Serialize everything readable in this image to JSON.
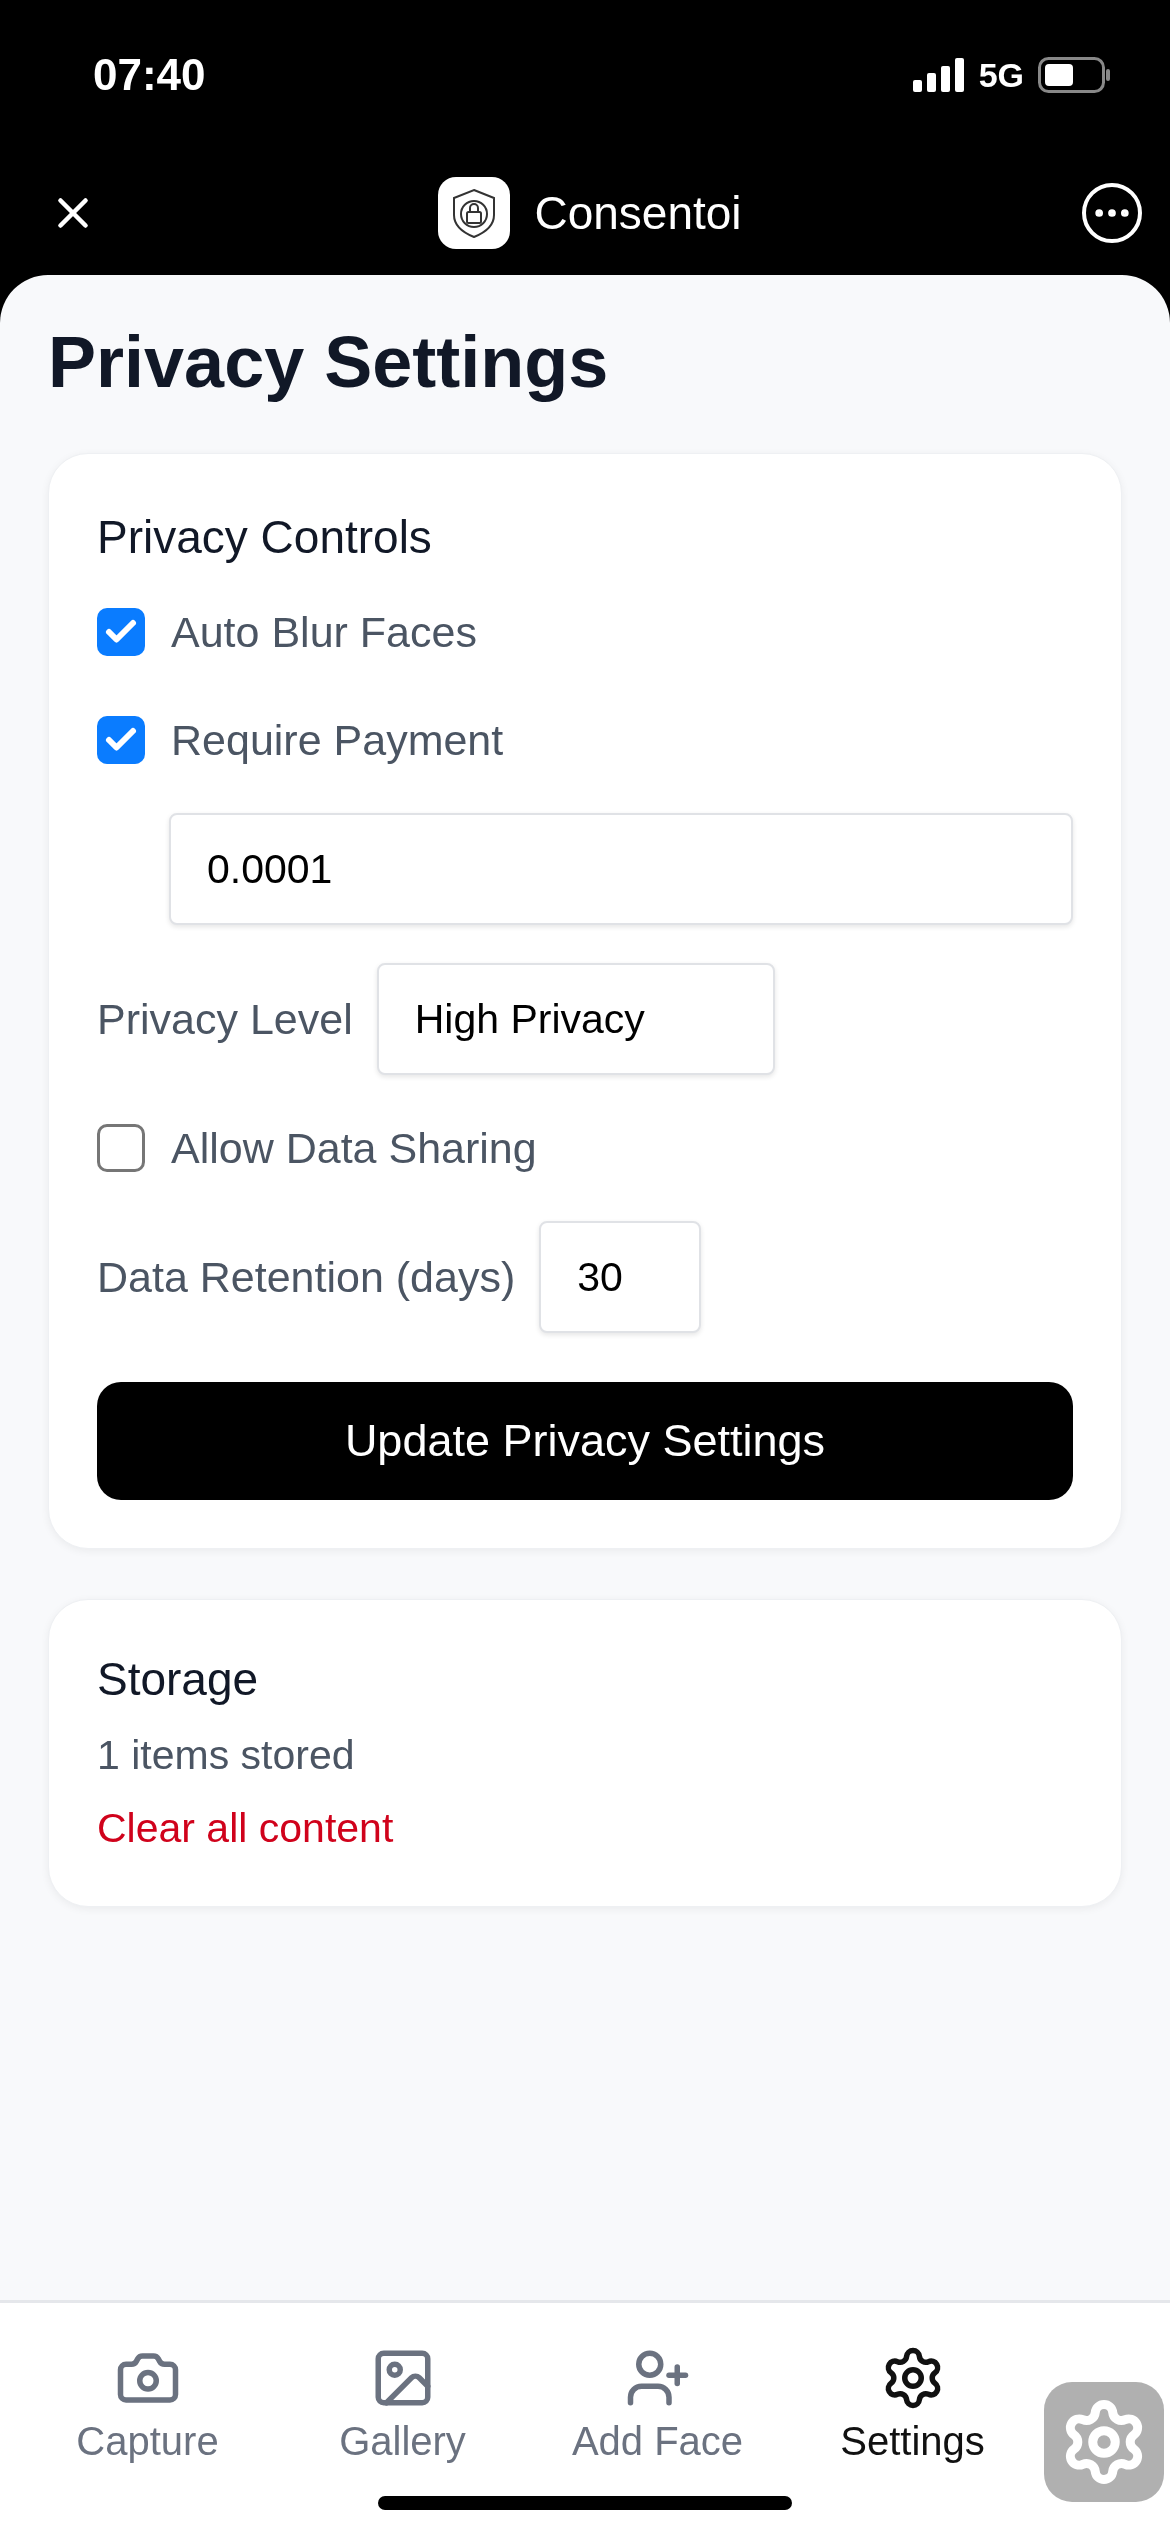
{
  "status_bar": {
    "time": "07:40",
    "network": "5G"
  },
  "nav_bar": {
    "title": "Consentoi"
  },
  "page": {
    "title": "Privacy Settings"
  },
  "privacy_controls": {
    "title": "Privacy Controls",
    "rows": [
      {
        "kind": "checkbox",
        "label": "Auto Blur Faces",
        "checked": true
      },
      {
        "kind": "checkbox",
        "label": "Require Payment",
        "checked": true
      },
      {
        "kind": "field",
        "value": "0.0001"
      },
      {
        "kind": "select",
        "label": "Privacy Level",
        "value": "High Privacy"
      },
      {
        "kind": "checkbox",
        "label": "Allow Data Sharing",
        "checked": false
      },
      {
        "kind": "number",
        "label": "Data Retention (days)",
        "value": "30"
      }
    ],
    "button": "Update Privacy Settings"
  },
  "storage": {
    "title": "Storage",
    "count": "1 items stored",
    "action": "Clear all content"
  },
  "tab_bar": [
    {
      "kind": "camera",
      "label": "Capture",
      "selected": false
    },
    {
      "kind": "gallery",
      "label": "Gallery",
      "selected": false
    },
    {
      "kind": "add-face",
      "label": "Add Face",
      "selected": false
    },
    {
      "kind": "settings",
      "label": "Settings",
      "selected": true
    }
  ]
}
